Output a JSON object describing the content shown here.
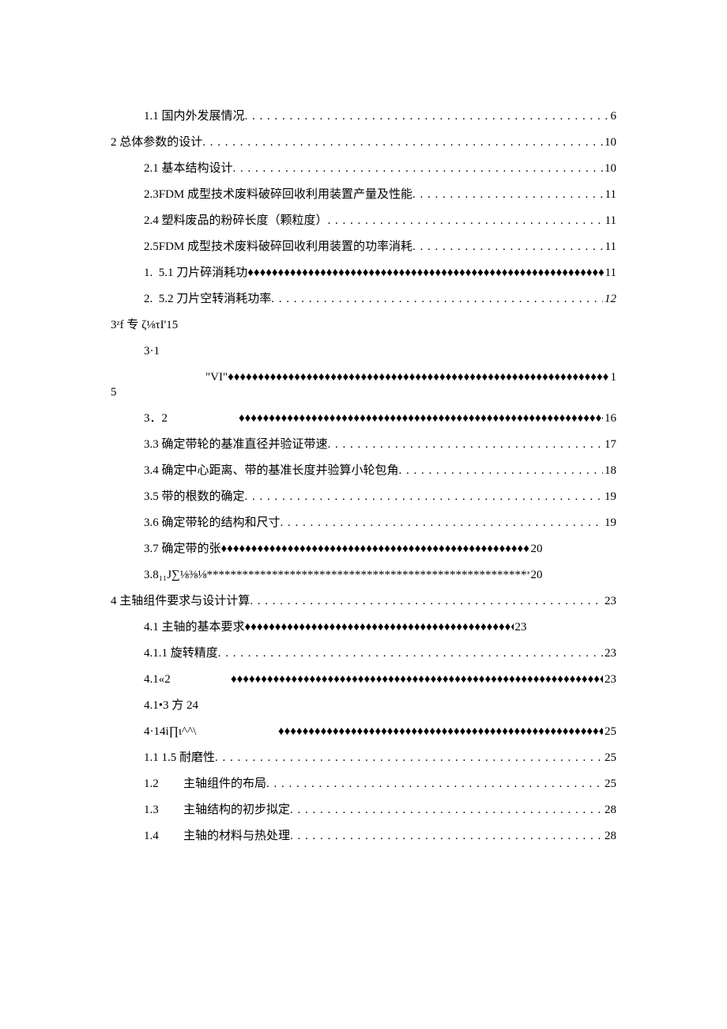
{
  "toc": {
    "e1": {
      "label": "1.1 国内外发展情况",
      "page": "6"
    },
    "e2": {
      "label": "2 总体参数的设计",
      "page": "10"
    },
    "e3": {
      "label": "2.1 基本结构设计",
      "page": "10"
    },
    "e4": {
      "label": "2.3FDM 成型技术废料破碎回收利用装置产量及性能",
      "page": "11"
    },
    "e5": {
      "label": "2.4 塑料废品的粉碎长度（颗粒度）",
      "page": "11"
    },
    "e6": {
      "label": "2.5FDM 成型技术废料破碎回收利用装置的功率消耗",
      "page": "11"
    },
    "e7": {
      "num": "1.",
      "label": "5.1 刀片碎消耗功",
      "page": "11"
    },
    "e8": {
      "num": "2.",
      "label": "5.2 刀片空转消耗功率",
      "page": "12"
    },
    "e9": {
      "text": "3ᶻf 专 ζ⅛τI'15"
    },
    "e10": {
      "label": "3·1",
      "label2": "\"VI\"",
      "page": "15"
    },
    "e11": {
      "label": "3．2",
      "page": "16"
    },
    "e12": {
      "label": "3.3 确定带轮的基准直径并验证带速",
      "page": "17"
    },
    "e13": {
      "label": "3.4 确定中心距离、带的基准长度并验算小轮包角",
      "page": "18"
    },
    "e14": {
      "label": "3.5 带的根数的确定",
      "page": "19"
    },
    "e15": {
      "label": "3.6 确定带轮的结构和尺寸",
      "page": "19"
    },
    "e16": {
      "label": "3.7 确定带的张",
      "page": "20"
    },
    "e17": {
      "label": "3.8₁₁J∑⅛⅜⅛",
      "page": "20"
    },
    "e18": {
      "label": "4 主轴组件要求与设计计算",
      "page": "23"
    },
    "e19": {
      "label": "4.1 主轴的基本要求",
      "page": "23"
    },
    "e20": {
      "label": "4.1.1 旋转精度",
      "page": "23"
    },
    "e21": {
      "label": "4.1«2",
      "page": "23"
    },
    "e22": {
      "text": "4.1•3 方 24"
    },
    "e23": {
      "label": "4·14i∏ι^^\\",
      "page": "25"
    },
    "e24": {
      "label": "1.1 1.5 耐磨性",
      "page": "25"
    },
    "e25": {
      "num": "1.2",
      "label": "主轴组件的布局",
      "page": "25"
    },
    "e26": {
      "num": "1.3",
      "label": "主轴结构的初步拟定",
      "page": "28"
    },
    "e27": {
      "num": "1.4",
      "label": "主轴的材料与热处理",
      "page": "28"
    }
  },
  "leaders": {
    "dots": ". . . . . . . . . . . . . . . . . . . . . . . . . . . . . . . . . . . . . . . . . . . . . . . . . . . . . . . . . . . . . . . . . . . . . . . . . . . . . . . . . . . . . . . . . . . . . . . . . . . . . . . . . . . . . . .",
    "diamonds": "♦♦♦♦♦♦♦♦♦♦♦♦♦♦♦♦♦♦♦♦♦♦♦♦♦♦♦♦♦♦♦♦♦♦♦♦♦♦♦♦♦♦♦♦♦♦♦♦♦♦♦♦♦♦♦♦♦♦♦♦♦♦♦♦♦♦♦♦♦♦♦♦♦♦♦♦♦♦♦♦",
    "stars": "********************************************************************************"
  }
}
